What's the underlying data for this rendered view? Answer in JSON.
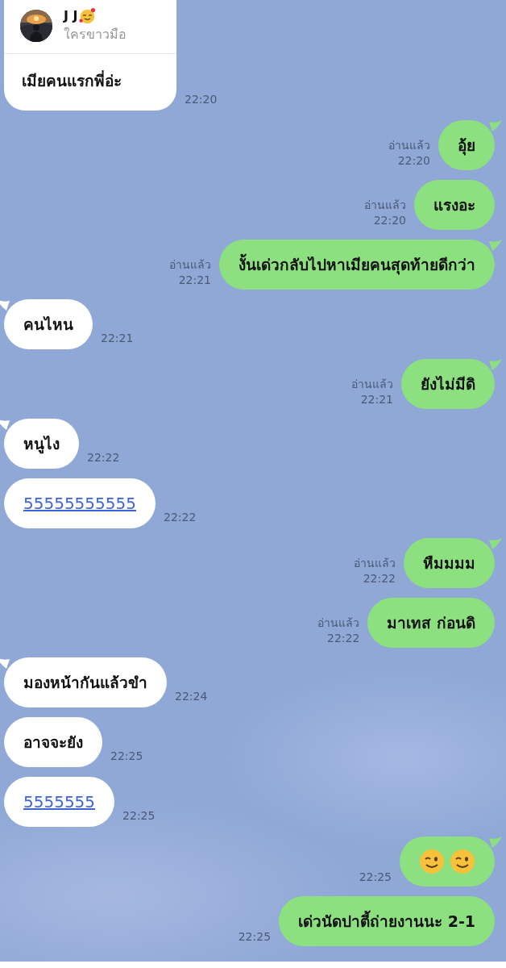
{
  "chat_header": {
    "name": "J J",
    "status": "ใครขาวมือ",
    "message": "เมียคนแรกพี่อ่ะ",
    "time": "22:20"
  },
  "messages": [
    {
      "kind": "sent",
      "text": "อุ้ย",
      "read": "อ่านแล้ว",
      "time": "22:20",
      "tail": true
    },
    {
      "kind": "sent",
      "text": "แรงอะ",
      "read": "อ่านแล้ว",
      "time": "22:20",
      "tail": false
    },
    {
      "kind": "sent",
      "text": "งั้นเด่วกลับไปหาเมียคนสุดท้ายดีกว่า",
      "read": "อ่านแล้ว",
      "time": "22:21",
      "tail": true
    },
    {
      "kind": "received",
      "text": "คนไหน",
      "time": "22:21",
      "tail": true
    },
    {
      "kind": "sent",
      "text": "ยังไม่มีดิ",
      "read": "อ่านแล้ว",
      "time": "22:21",
      "tail": true
    },
    {
      "kind": "received",
      "text": "หนูไง",
      "time": "22:22",
      "tail": true
    },
    {
      "kind": "received-link",
      "text": "55555555555",
      "time": "22:22",
      "tail": false
    },
    {
      "kind": "sent",
      "text": "หืมมมม",
      "read": "อ่านแล้ว",
      "time": "22:22",
      "tail": true
    },
    {
      "kind": "sent",
      "text": "มาเทส ก่อนดิ",
      "read": "อ่านแล้ว",
      "time": "22:22",
      "tail": false
    },
    {
      "kind": "received",
      "text": "มองหน้ากันแล้วขำ",
      "time": "22:24",
      "tail": true
    },
    {
      "kind": "received",
      "text": "อาจจะยัง",
      "time": "22:25",
      "tail": false
    },
    {
      "kind": "received-link",
      "text": "5555555",
      "time": "22:25",
      "tail": false
    },
    {
      "kind": "sent-emoji",
      "time": "22:25",
      "tail": true
    },
    {
      "kind": "sent",
      "text": "เด่วนัดปาตี้ถ่ายงานนะ 2-1",
      "time": "22:25",
      "tail": false
    }
  ]
}
